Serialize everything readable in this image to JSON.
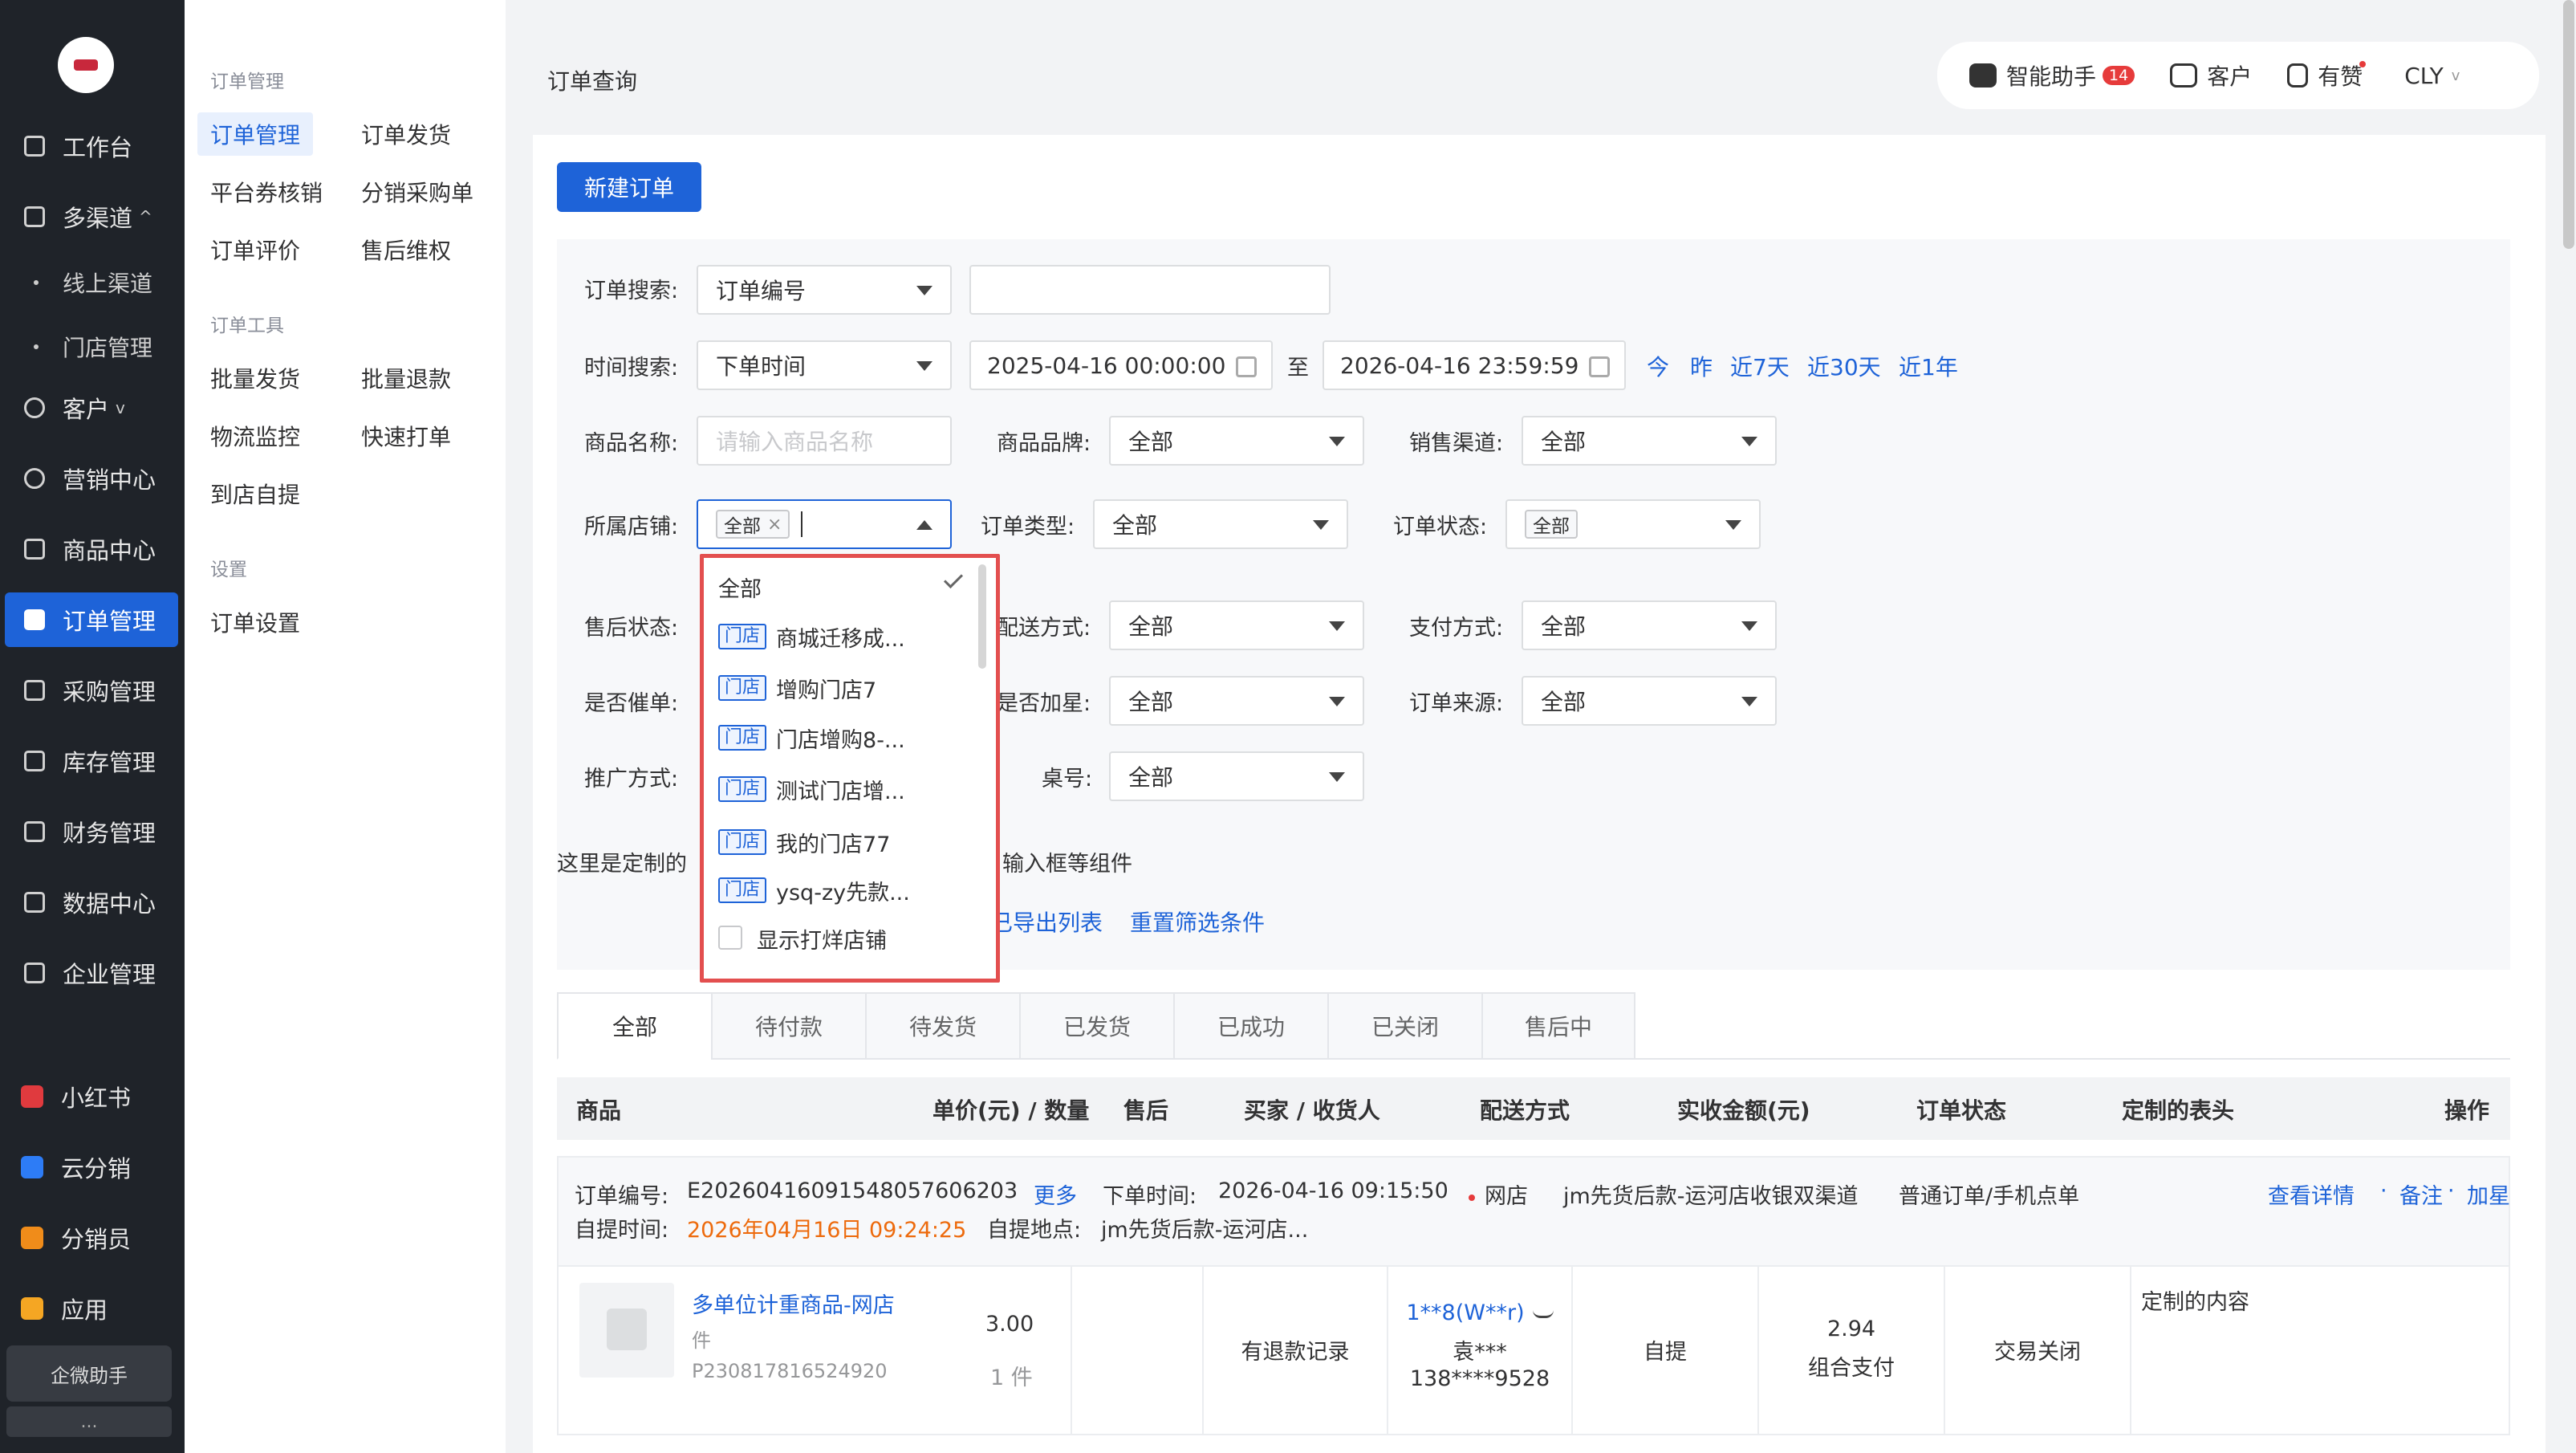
{
  "nav": {
    "items": [
      "工作台",
      "多渠道",
      "客户",
      "营销中心",
      "商品中心",
      "订单管理",
      "采购管理",
      "库存管理",
      "财务管理",
      "数据中心",
      "企业管理"
    ],
    "subitems": [
      "线上渠道",
      "门店管理"
    ],
    "ext": [
      "小红书",
      "云分销",
      "分销员",
      "应用"
    ],
    "qiwei": "企微助手",
    "more": "...",
    "colors": {
      "xhs": "#e03a3e",
      "yfx": "#2d7cf6",
      "fxy": "#f08c1a",
      "app": "#f5a623"
    }
  },
  "subnav": {
    "groups": [
      "订单管理",
      "订单工具",
      "设置"
    ],
    "items": [
      "订单管理",
      "订单发货",
      "平台券核销",
      "分销采购单",
      "订单评价",
      "售后维权",
      "批量发货",
      "批量退款",
      "物流监控",
      "快速打单",
      "到店自提",
      "订单设置"
    ]
  },
  "page_title": "订单查询",
  "topbar": {
    "assistant": "智能助手",
    "badge": "14",
    "customer": "客户",
    "like": "有赞",
    "user": "CLY"
  },
  "new_order": "新建订单",
  "filters": {
    "order_search_label": "订单搜索:",
    "order_search_type": "订单编号",
    "order_search_value": "",
    "time_search_label": "时间搜索:",
    "time_type": "下单时间",
    "start": "2025-04-16 00:00:00",
    "to": "至",
    "end": "2026-04-16 23:59:59",
    "quick": [
      "今",
      "昨",
      "近7天",
      "近30天",
      "近1年"
    ],
    "product_name_label": "商品名称:",
    "product_name_placeholder": "请输入商品名称",
    "brand_label": "商品品牌:",
    "brand": "全部",
    "channel_label": "销售渠道:",
    "channel": "全部",
    "store_label": "所属店铺:",
    "store_tag": "全部",
    "order_type_label": "订单类型:",
    "order_type": "全部",
    "order_status_label": "订单状态:",
    "order_status_tag": "全部",
    "aftersale_label": "售后状态:",
    "delivery_label": "配送方式:",
    "delivery": "全部",
    "payment_label": "支付方式:",
    "payment": "全部",
    "urge_label": "是否催单:",
    "star_label": "是否加星:",
    "star": "全部",
    "source_label": "订单来源:",
    "source": "全部",
    "promo_label": "推广方式:",
    "table_label": "桌号:",
    "table": "全部",
    "custom_text_left": "这里是定制的",
    "custom_text_right": "、输入框等组件",
    "export_list": "已导出列表",
    "reset": "重置筛选条件"
  },
  "dropdown": {
    "all": "全部",
    "tag": "门店",
    "options": [
      "商城迁移成...",
      "增购门店7",
      "门店增购8-...",
      "测试门店增...",
      "我的门店77",
      "ysq-zy先款..."
    ],
    "show_sample": "显示打烊店铺"
  },
  "tabs": [
    "全部",
    "待付款",
    "待发货",
    "已发货",
    "已成功",
    "已关闭",
    "售后中"
  ],
  "table": {
    "headers": [
      "商品",
      "单价(元) / 数量",
      "售后",
      "买家 / 收货人",
      "配送方式",
      "实收金额(元)",
      "订单状态",
      "定制的表头",
      "操作"
    ]
  },
  "order": {
    "no_label": "订单编号:",
    "no": "E20260416091548057606203",
    "more": "更多",
    "time_label": "下单时间:",
    "time": "2026-04-16 09:15:50",
    "channel": "网店",
    "store": "jm先货后款-运河店收银双渠道",
    "type": "普通订单/手机点单",
    "pickup_time_label": "自提时间:",
    "pickup_time": "2026年04月16日 09:24:25",
    "pickup_loc_label": "自提地点:",
    "pickup_loc": "jm先货后款-运河店...",
    "actions": [
      "查看详情",
      "·",
      "备注",
      "·",
      "加星"
    ],
    "product": "多单位计重商品-网店",
    "unit": "件",
    "sku": "P230817816524920",
    "price": "3.00",
    "qty": "1 件",
    "aftersale": "有退款记录",
    "buyer": "1**8(W**r)",
    "receiver": "袁***",
    "phone": "138****9528",
    "delivery": "自提",
    "amount": "2.94",
    "pay_type": "组合支付",
    "status": "交易关闭",
    "custom": "定制的内容"
  }
}
